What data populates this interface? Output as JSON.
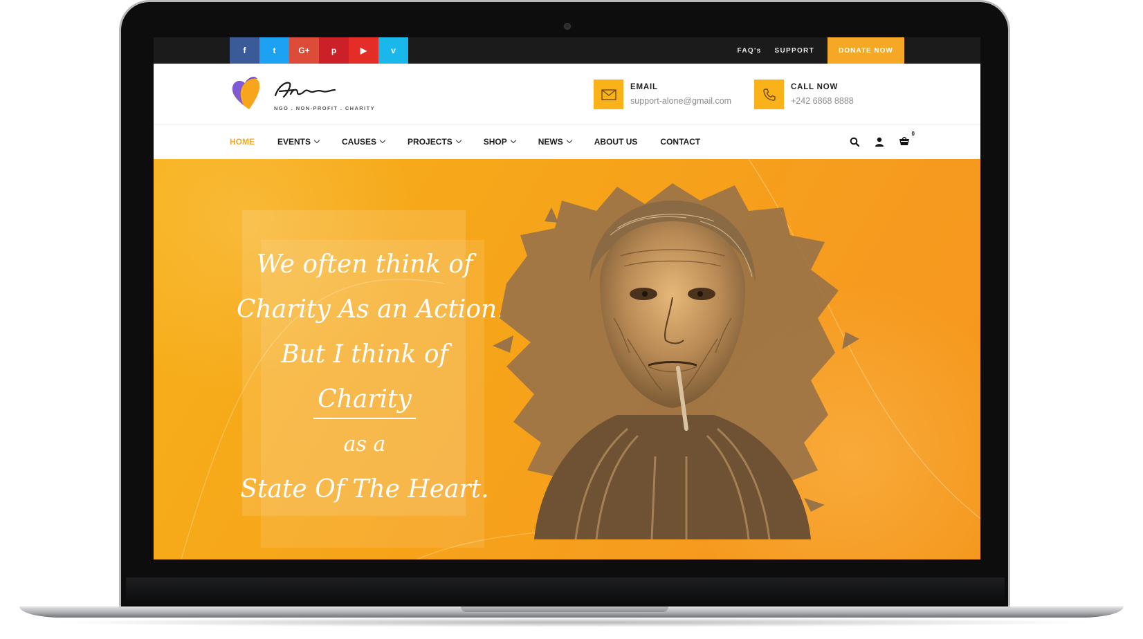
{
  "topbar": {
    "social": [
      {
        "icon": "facebook-icon",
        "glyph": "f",
        "color": "#3b5a98"
      },
      {
        "icon": "twitter-icon",
        "glyph": "t",
        "color": "#1da1f2"
      },
      {
        "icon": "google-plus-icon",
        "glyph": "G+",
        "color": "#dd4b39"
      },
      {
        "icon": "pinterest-icon",
        "glyph": "p",
        "color": "#cb2027"
      },
      {
        "icon": "youtube-icon",
        "glyph": "▶",
        "color": "#e52d27"
      },
      {
        "icon": "vimeo-icon",
        "glyph": "v",
        "color": "#1ab7ea"
      }
    ],
    "faq_label": "FAQ's",
    "support_label": "SUPPORT",
    "donate_label": "DONATE NOW",
    "background": "#1b1b1c",
    "accent": "#f4a825"
  },
  "header": {
    "logo_script": "Alone",
    "logo_tagline": "NGO . NON-PROFIT . CHARITY",
    "email": {
      "icon": "envelope-icon",
      "title": "EMAIL",
      "value": "support-alone@gmail.com"
    },
    "phone": {
      "icon": "phone-icon",
      "title": "CALL NOW",
      "value": "+242 6868 8888"
    },
    "icon_bg": "#f9b219"
  },
  "nav": {
    "items": [
      {
        "label": "HOME",
        "active": true,
        "dropdown": false
      },
      {
        "label": "EVENTS",
        "active": false,
        "dropdown": true
      },
      {
        "label": "CAUSES",
        "active": false,
        "dropdown": true
      },
      {
        "label": "PROJECTS",
        "active": false,
        "dropdown": true
      },
      {
        "label": "SHOP",
        "active": false,
        "dropdown": true
      },
      {
        "label": "NEWS",
        "active": false,
        "dropdown": true
      },
      {
        "label": "ABOUT US",
        "active": false,
        "dropdown": false
      },
      {
        "label": "CONTACT",
        "active": false,
        "dropdown": false
      }
    ],
    "tools": [
      "search-icon",
      "user-icon",
      "cart-icon"
    ],
    "cart_count": "0"
  },
  "hero": {
    "quote_lines": [
      "We often think of",
      "Charity As an Action.",
      "But I think of",
      "Charity",
      "as a",
      "State Of The Heart."
    ],
    "background": "#f6a31a"
  }
}
